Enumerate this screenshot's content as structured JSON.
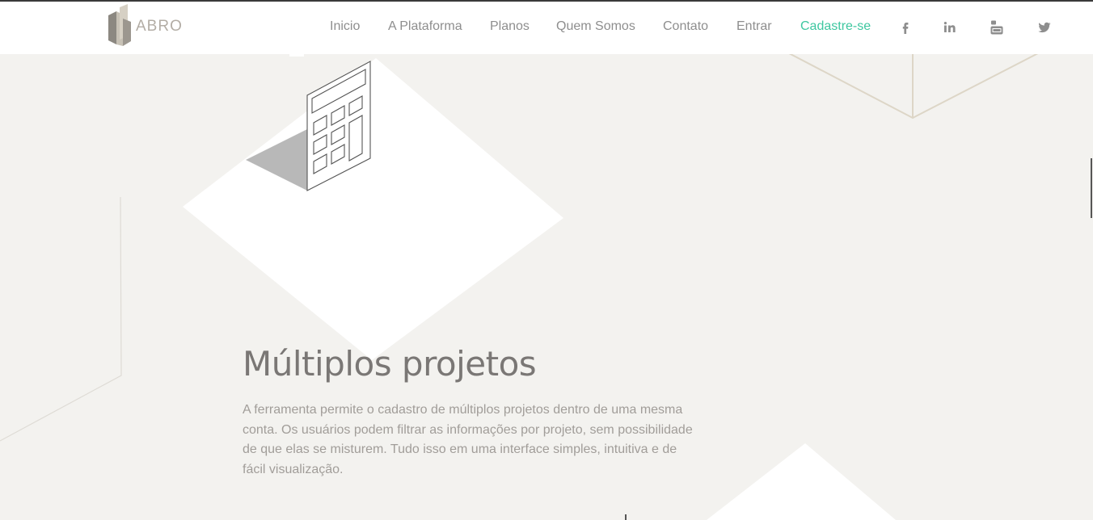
{
  "brand": {
    "logo_text": "ABRO"
  },
  "nav": {
    "items": [
      {
        "label": "Inicio"
      },
      {
        "label": "A Plataforma"
      },
      {
        "label": "Planos"
      },
      {
        "label": "Quem Somos"
      },
      {
        "label": "Contato"
      },
      {
        "label": "Entrar"
      },
      {
        "label": "Cadastre-se"
      }
    ],
    "social": [
      "facebook-icon",
      "linkedin-icon",
      "youtube-icon",
      "twitter-icon"
    ],
    "accent_color": "#3ec7a0"
  },
  "section": {
    "title": "Múltiplos projetos",
    "description": "A ferramenta permite o cadastro de múltiplos projetos dentro de uma mesma conta. Os usuários podem filtrar as informações por projeto, sem possibilidade de que elas se misturem. Tudo isso em uma interface simples, intuitiva e de fácil visualização."
  },
  "colors": {
    "background": "#f3f2ef",
    "heading": "#7a7775",
    "text": "#a19d99",
    "nav_text": "#8e8e8e"
  }
}
